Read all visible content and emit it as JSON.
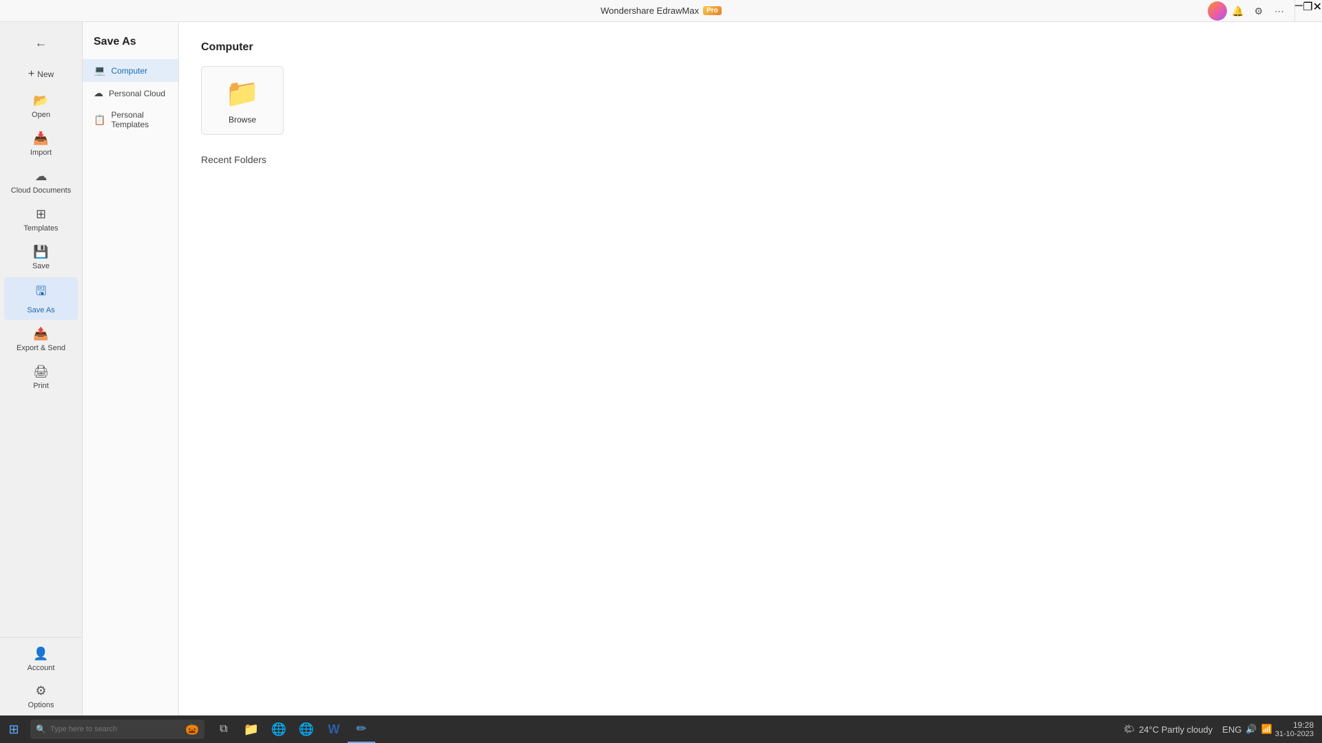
{
  "app": {
    "title": "Wondershare EdrawMax",
    "pro_badge": "Pro"
  },
  "title_bar": {
    "minimize": "─",
    "restore": "❐",
    "close": "✕"
  },
  "sidebar": {
    "back_icon": "←",
    "items": [
      {
        "id": "new",
        "label": "New",
        "icon": "+"
      },
      {
        "id": "open",
        "label": "Open",
        "icon": "📂"
      },
      {
        "id": "import",
        "label": "Import",
        "icon": "📥"
      },
      {
        "id": "cloud",
        "label": "Cloud Documents",
        "icon": "☁"
      },
      {
        "id": "templates",
        "label": "Templates",
        "icon": "⊞"
      },
      {
        "id": "save",
        "label": "Save",
        "icon": "💾"
      },
      {
        "id": "saveas",
        "label": "Save As",
        "icon": "🖫",
        "active": true
      },
      {
        "id": "export",
        "label": "Export & Send",
        "icon": "📤"
      },
      {
        "id": "print",
        "label": "Print",
        "icon": "🖨"
      }
    ],
    "bottom_items": [
      {
        "id": "account",
        "label": "Account",
        "icon": "👤"
      },
      {
        "id": "options",
        "label": "Options",
        "icon": "⚙"
      }
    ]
  },
  "save_as_panel": {
    "title": "Save As",
    "nav_items": [
      {
        "id": "computer",
        "label": "Computer",
        "icon": "💻",
        "active": true
      },
      {
        "id": "personal_cloud",
        "label": "Personal Cloud",
        "icon": "☁"
      },
      {
        "id": "personal_templates",
        "label": "Personal Templates",
        "icon": "📋"
      }
    ]
  },
  "main": {
    "section_title": "Computer",
    "browse_label": "Browse",
    "recent_folders_title": "Recent Folders"
  },
  "taskbar": {
    "search_placeholder": "Type here to search",
    "halloween_emoji": "🎃",
    "time": "19:28",
    "date": "31-10-2023",
    "weather": "24°C  Partly cloudy",
    "lang": "ENG",
    "apps": [
      {
        "id": "start",
        "icon": "⊞"
      },
      {
        "id": "search",
        "icon": "🔍"
      },
      {
        "id": "taskview",
        "icon": "⧉"
      },
      {
        "id": "explorer",
        "icon": "📁"
      },
      {
        "id": "chrome",
        "icon": "🌐"
      },
      {
        "id": "chrome2",
        "icon": "🌐"
      },
      {
        "id": "word",
        "icon": "W"
      },
      {
        "id": "edraw",
        "icon": "✏",
        "active": true
      }
    ]
  }
}
